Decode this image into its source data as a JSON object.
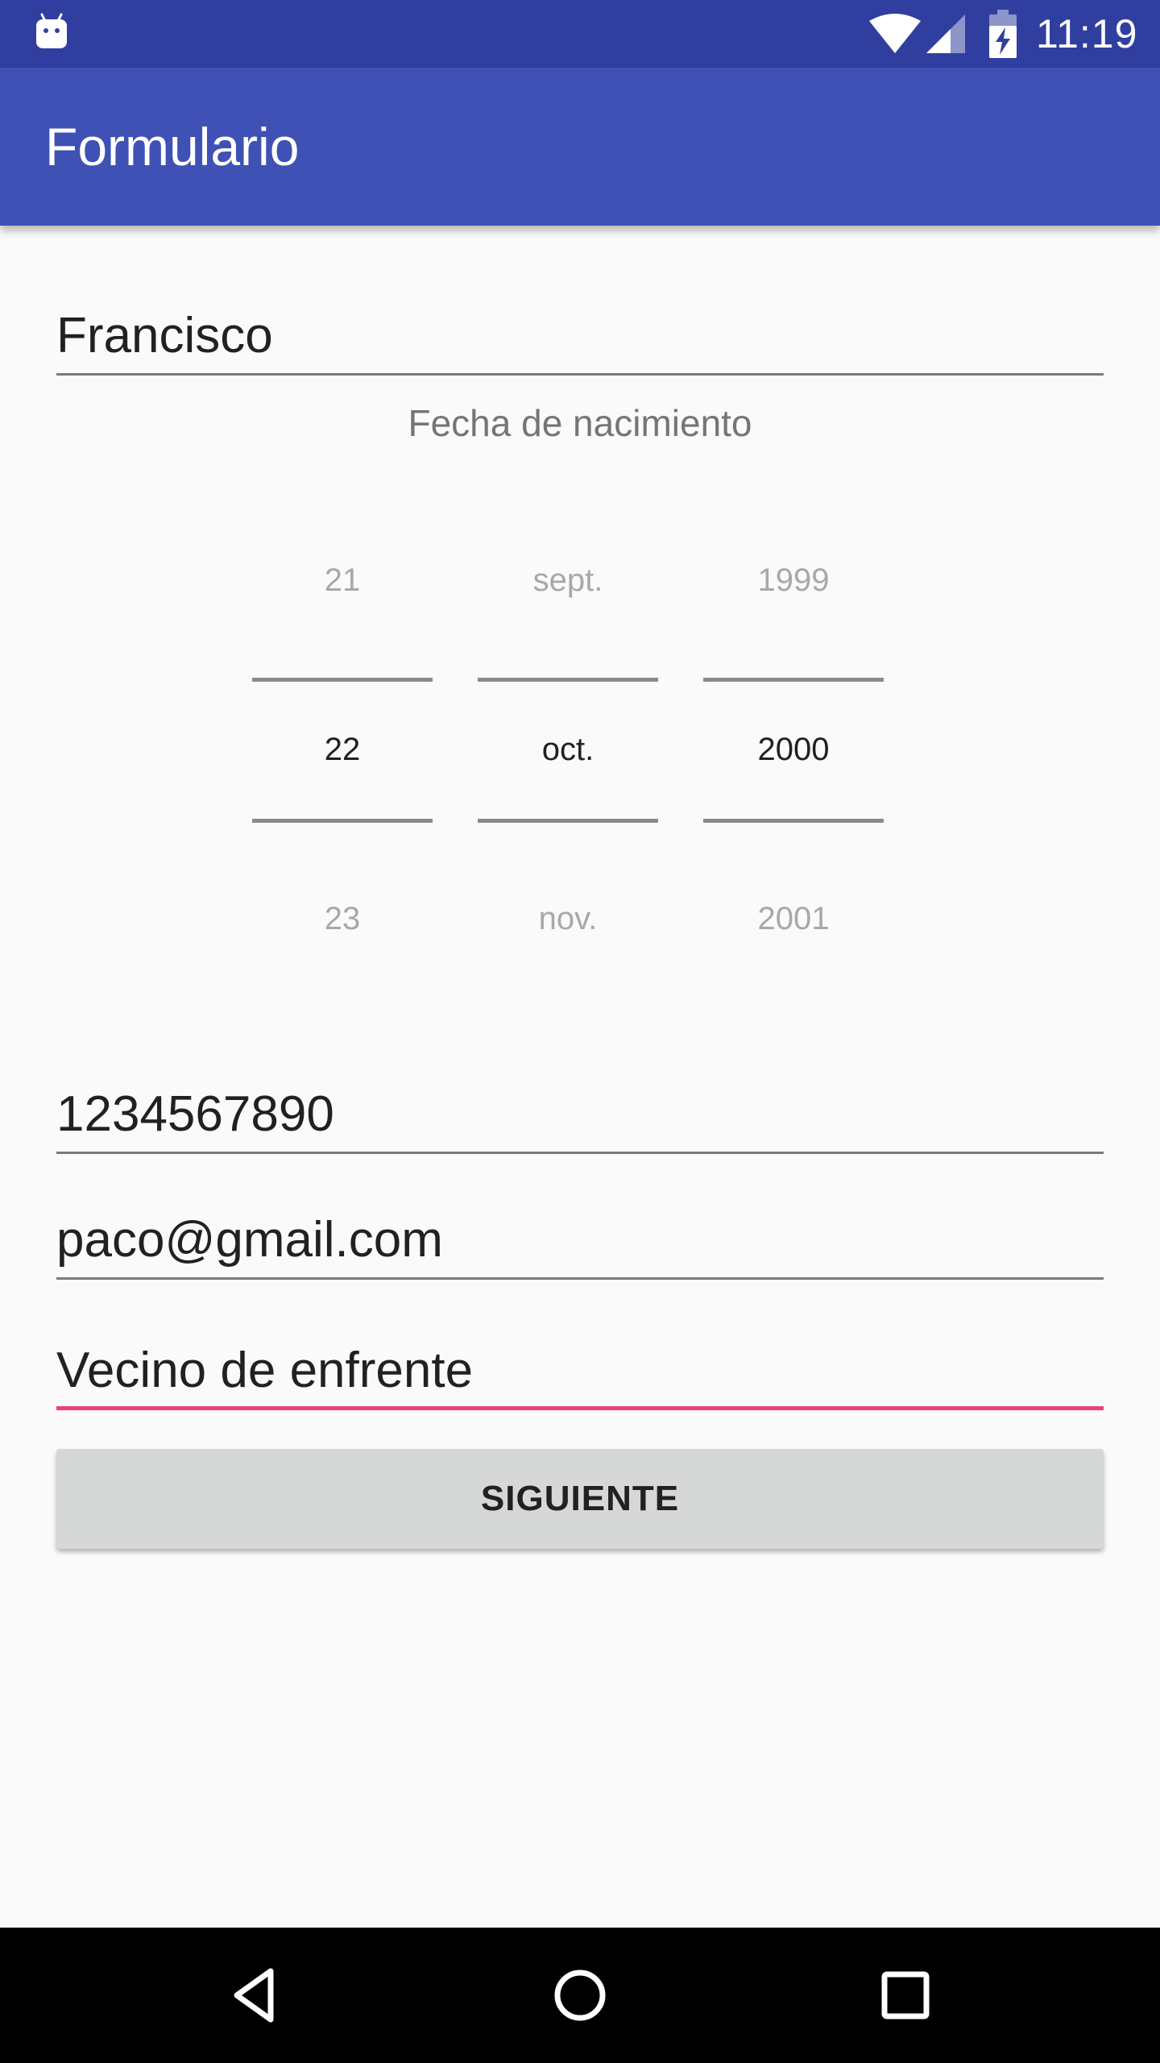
{
  "status_bar": {
    "time": "11:19",
    "icons": [
      "android-debug-icon",
      "wifi-icon",
      "cell-signal-icon",
      "battery-charging-icon"
    ]
  },
  "app_bar": {
    "title": "Formulario",
    "color": "#3f51b5",
    "status_color": "#303f9f"
  },
  "form": {
    "name": "Francisco",
    "date_label": "Fecha de nacimiento",
    "date_picker": {
      "day": {
        "prev": "21",
        "current": "22",
        "next": "23"
      },
      "month": {
        "prev": "sept.",
        "current": "oct.",
        "next": "nov."
      },
      "year": {
        "prev": "1999",
        "current": "2000",
        "next": "2001"
      }
    },
    "phone": "1234567890",
    "email": "paco@gmail.com",
    "notes": "Vecino de enfrente",
    "next_button": "SIGUIENTE",
    "accent_color": "#e91e63"
  },
  "nav_bar": {
    "buttons": [
      "back-icon",
      "home-icon",
      "recents-icon"
    ]
  }
}
